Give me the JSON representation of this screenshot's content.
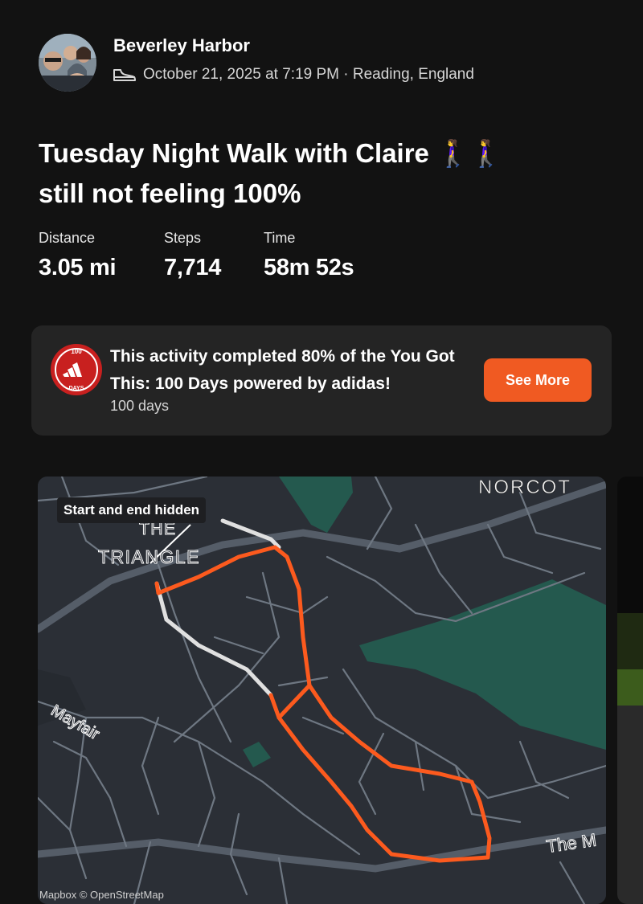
{
  "header": {
    "athlete_name": "Beverley Harbor",
    "meta": "October 21, 2025 at 7:19 PM · Reading, England",
    "activity_icon": "walking-shoe-icon"
  },
  "activity": {
    "title_line1": "Tuesday Night Walk with Claire 🚶‍♀️🚶‍♀️",
    "title_line2": "still not feeling 100%"
  },
  "stats": [
    {
      "label": "Distance",
      "value": "3.05 mi"
    },
    {
      "label": "Steps",
      "value": "7,714"
    },
    {
      "label": "Time",
      "value": "58m 52s"
    }
  ],
  "challenge": {
    "text": "This activity completed 80% of the You Got This: 100 Days powered by adidas!",
    "subtitle": "100 days",
    "button_label": "See More",
    "badge_top": "100",
    "badge_bottom": "DAYS",
    "badge_icon": "adidas-badge-icon",
    "accent": "#f05a22",
    "badge_color": "#c8201f"
  },
  "map": {
    "privacy_label": "Start and end hidden",
    "labels": {
      "norcot": "NORCOT",
      "the": "THE",
      "triangle": "TRIANGLE",
      "mayfair": "Mayfair",
      "the_m": "The M"
    },
    "attribution": "Mapbox © OpenStreetMap",
    "route_color": "#fc5a1e",
    "hidden_route_color": "#d9d9d9",
    "park_color": "#24594e"
  }
}
